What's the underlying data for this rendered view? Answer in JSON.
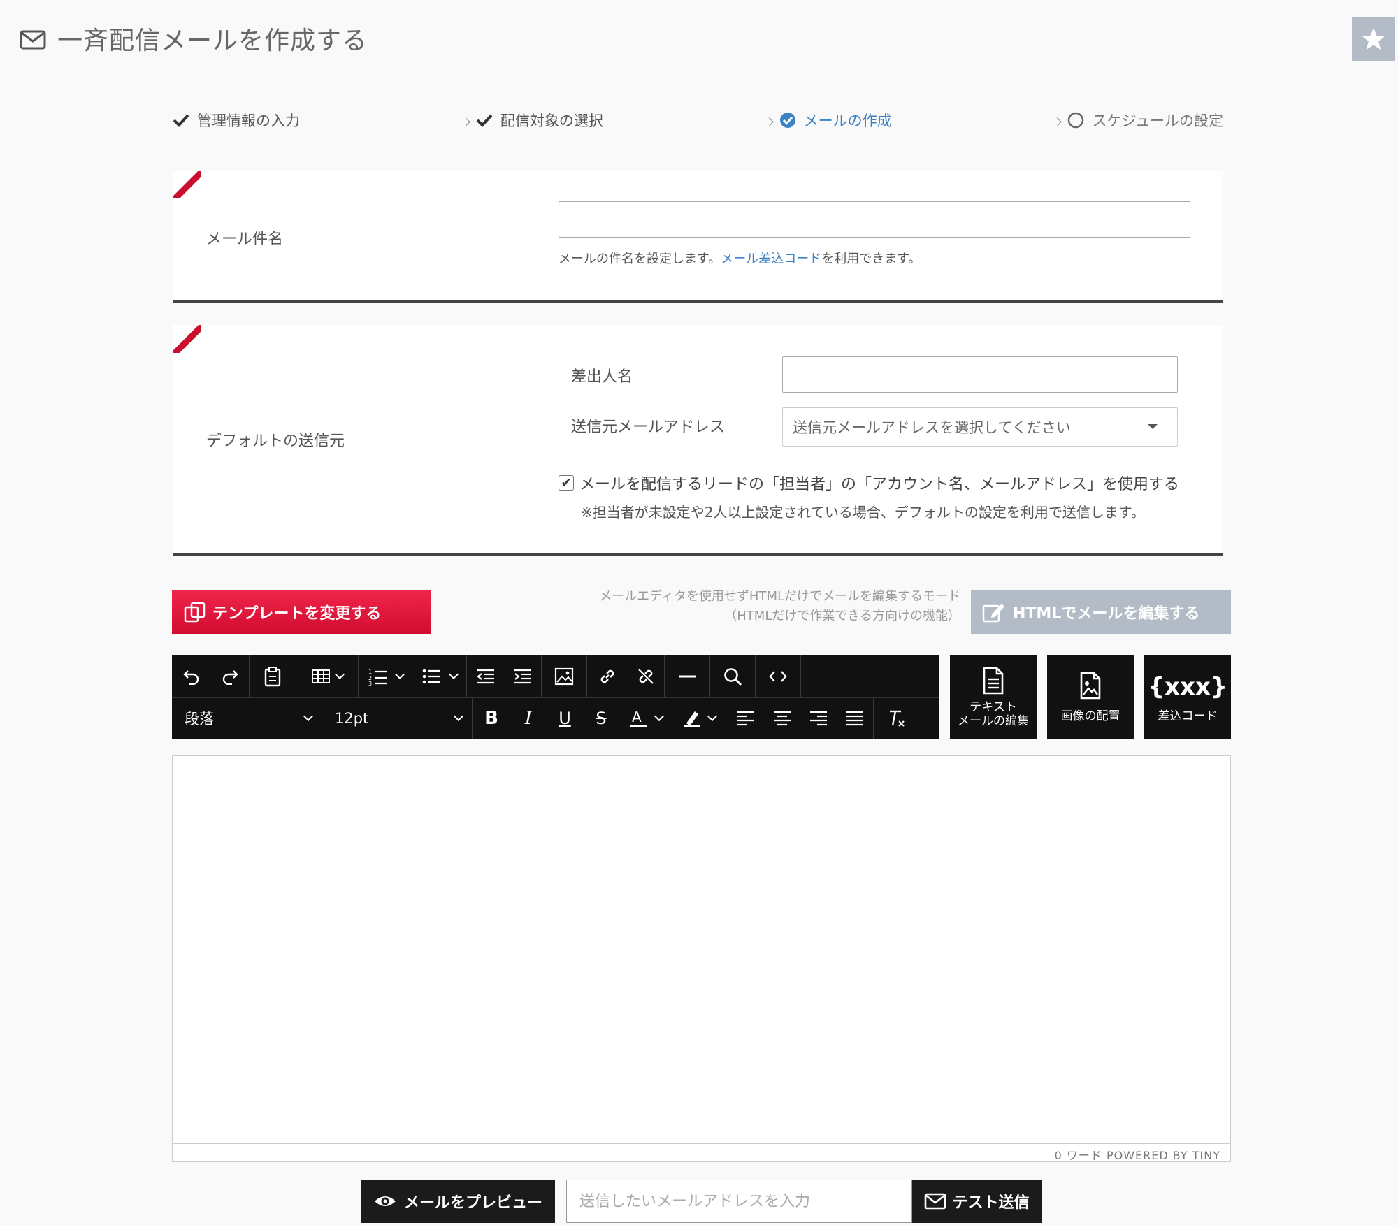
{
  "header": {
    "title": "一斉配信メールを作成する",
    "title_icon": "envelope-icon",
    "favorite_icon": "star-icon"
  },
  "steps": [
    {
      "label": "管理情報の入力",
      "state": "done"
    },
    {
      "label": "配信対象の選択",
      "state": "done"
    },
    {
      "label": "メールの作成",
      "state": "active"
    },
    {
      "label": "スケジュールの設定",
      "state": "todo"
    }
  ],
  "subject": {
    "label": "メール件名",
    "value": "",
    "help_before": "メールの件名を設定します。",
    "help_link": "メール差込コード",
    "help_after": "を利用できます。"
  },
  "sender": {
    "label": "デフォルトの送信元",
    "name_label": "差出人名",
    "name_value": "",
    "address_label": "送信元メールアドレス",
    "address_placeholder": "送信元メールアドレスを選択してください",
    "checkbox_checked": true,
    "checkbox_label": "メールを配信するリードの「担当者」の「アカウント名、メールアドレス」を使用する",
    "note": "※担当者が未設定や2人以上設定されている場合、デフォルトの設定を利用で送信します。"
  },
  "actions": {
    "template_button": "テンプレートを変更する",
    "html_note_1": "メールエディタを使用せずHTMLだけでメールを編集するモード",
    "html_note_2": "（HTMLだけで作業できる方向けの機能）",
    "html_button": "HTMLでメールを編集する"
  },
  "toolbar": {
    "block_format": "段落",
    "font_size": "12pt",
    "side_buttons": {
      "text_edit_1": "テキスト",
      "text_edit_2": "メールの編集",
      "image_layout": "画像の配置",
      "merge_code_symbol": "{xxx}",
      "merge_code": "差込コード"
    }
  },
  "editor": {
    "status": "0 ワード  POWERED BY TINY"
  },
  "bottom": {
    "preview_button": "メールをプレビュー",
    "test_placeholder": "送信したいメールアドレスを入力",
    "test_button": "テスト送信"
  },
  "colors": {
    "accent_red": "#d10c30",
    "link_blue": "#3b82c4",
    "toolbar_bg": "#111111",
    "disabled_gray": "#b3bcc6"
  }
}
